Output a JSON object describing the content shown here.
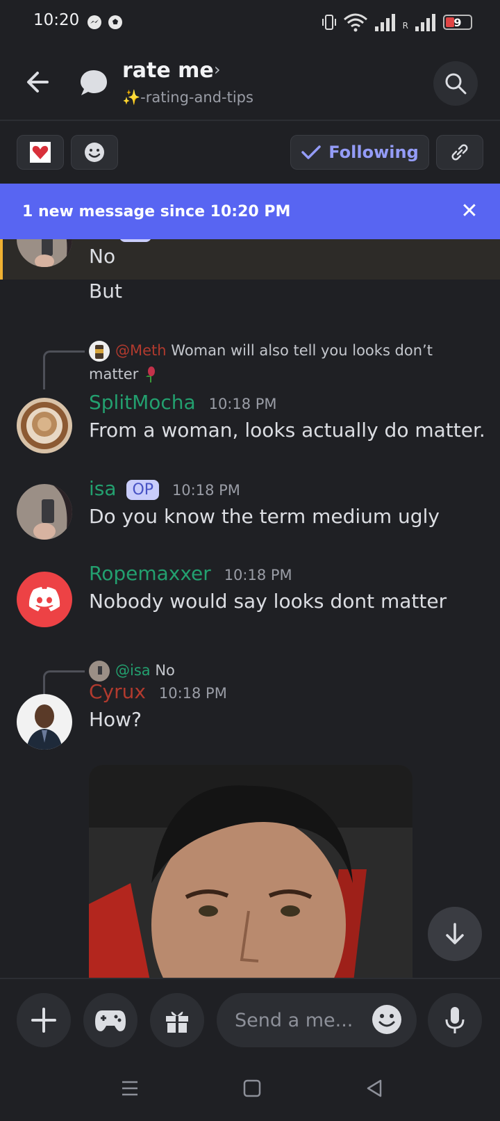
{
  "status_bar": {
    "time": "10:20",
    "battery": "9",
    "carrier_label": "R"
  },
  "header": {
    "title": "rate me",
    "channel": "✨-rating-and-tips"
  },
  "toolbar": {
    "following_label": "Following"
  },
  "banner": {
    "text": "1 new message since 10:20 PM"
  },
  "messages": {
    "m0": {
      "lines": [
        "No",
        "But"
      ]
    },
    "m1": {
      "reply_mention": "@Meth",
      "reply_text_1": "Woman will also tell you looks don’t",
      "reply_text_2": "matter",
      "author": "SplitMocha",
      "time": "10:18 PM",
      "text": "From a woman, looks actually do matter."
    },
    "m2": {
      "author": "isa",
      "badge": "OP",
      "time": "10:18 PM",
      "text": "Do you know the term medium ugly"
    },
    "m3": {
      "author": "Ropemaxxer",
      "time": "10:18 PM",
      "text": "Nobody would say looks dont matter"
    },
    "m4": {
      "reply_mention": "@isa",
      "reply_text": "No",
      "author": "Cyrux",
      "time": "10:18 PM",
      "text": "How?"
    }
  },
  "composer": {
    "placeholder": "Send a me..."
  },
  "colors": {
    "accent": "#5865f2",
    "green_name": "#23a06f",
    "red_name": "#b13a2e",
    "background": "#1f2024"
  }
}
